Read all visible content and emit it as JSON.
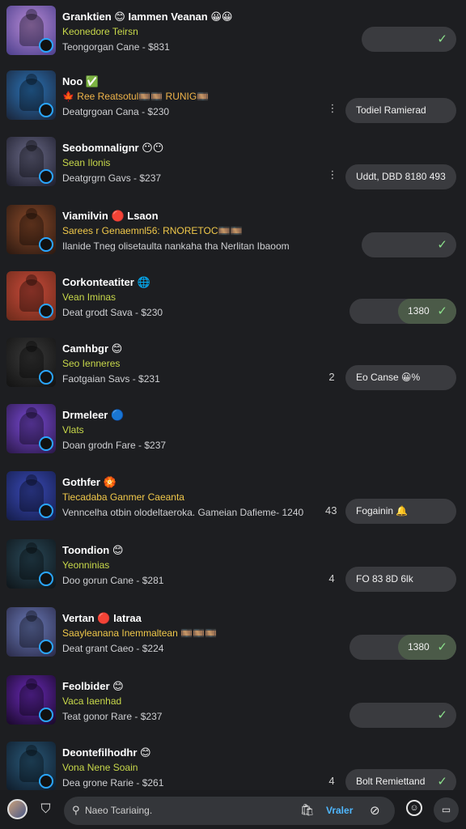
{
  "rows": [
    {
      "title": "Granktien 😊 Iammen Veanan 😀😀",
      "subtitle": "Keonedore Teirsn",
      "subtitle_color": "#c8d84a",
      "meta": "Teongorgan Cane - $831",
      "more": "",
      "pill_text": "",
      "pill_segment": "",
      "pill_check": "✓",
      "thumb_colors": [
        "#b98bd6",
        "#4b3f8c"
      ]
    },
    {
      "title": "Noo ✅",
      "subtitle": "🍁 Ree Reatsotul🎞️🎞️ RUNIG🎞️",
      "subtitle_color": "#f0b44a",
      "meta": "Deatgrgoan Cana - $230",
      "more": "⋮",
      "pill_text": "Todiel Ramierad",
      "pill_segment": "",
      "pill_check": "",
      "thumb_colors": [
        "#2b74b8",
        "#1a2438"
      ]
    },
    {
      "title": "Seobomnalignr 😶😶",
      "subtitle": "Sean Ilonis",
      "subtitle_color": "#c8d84a",
      "meta": "Deatgrgrn Gavs - $237",
      "more": "⋮",
      "pill_text": "Uddt, DBD 8180 493",
      "pill_segment": "",
      "pill_check": "",
      "thumb_colors": [
        "#6a6a88",
        "#1e1e2c"
      ]
    },
    {
      "title": "Viamilvin 🔴 Lsaon",
      "subtitle": "Sarees r Genaemnl56: RNORETOC🎞️🎞️",
      "subtitle_color": "#f0c84a",
      "meta": "Ilanide Tneg olisetaulta nankaha tha Nerlitan Ibaoom",
      "more": "",
      "pill_text": "",
      "pill_segment": "",
      "pill_check": "✓",
      "thumb_colors": [
        "#8a4a2a",
        "#2a1810"
      ]
    },
    {
      "title": "Corkonteatiter 🌐",
      "subtitle": "Vean Iminas",
      "subtitle_color": "#c8d84a",
      "meta": "Deat grodt Sava - $230",
      "more": "",
      "pill_text": "",
      "pill_segment": "1380",
      "pill_check": "✓",
      "thumb_colors": [
        "#c94a3a",
        "#6a2a1a"
      ]
    },
    {
      "title": "Camhbgr 😊",
      "subtitle": "Seo Ienneres",
      "subtitle_color": "#c8d84a",
      "meta": "Faotgaian Savs - $231",
      "more": "2",
      "pill_text": "Eo Canse 😀%",
      "pill_segment": "",
      "pill_check": "",
      "thumb_colors": [
        "#3a3a3a",
        "#121212"
      ]
    },
    {
      "title": "Drmeleer 🔵",
      "subtitle": "Vlats",
      "subtitle_color": "#c8d84a",
      "meta": "Doan grodn Fare - $237",
      "more": "",
      "pill_text": "",
      "pill_segment": "",
      "pill_check": "",
      "thumb_colors": [
        "#7a4ad6",
        "#2a1848"
      ]
    },
    {
      "title": "Gothfer 🏵️",
      "subtitle": "Tiecadaba Ganmer Caeanta",
      "subtitle_color": "#f0c84a",
      "meta": "Venncelha otbin olodeltaeroka. Gameian Dafieme- 1240",
      "more": "43",
      "pill_text": "Fogainin 🔔",
      "pill_segment": "",
      "pill_check": "",
      "thumb_colors": [
        "#3a4ab8",
        "#141c48"
      ]
    },
    {
      "title": "Toondion 😊",
      "subtitle": "Yeonninias",
      "subtitle_color": "#c8d84a",
      "meta": "Doo gorun Cane - $281",
      "more": "4",
      "pill_text": "FO 83 8D 6lk",
      "pill_segment": "",
      "pill_check": "",
      "thumb_colors": [
        "#2a4a5a",
        "#0e1418"
      ]
    },
    {
      "title": "Vertan 🔴 Iatraa",
      "subtitle": "Saayleanana Inemmaltean 🎞️🎞️🎞️",
      "subtitle_color": "#f0c84a",
      "meta": "Deat grant Caeo - $224",
      "more": "",
      "pill_text": "",
      "pill_segment": "1380",
      "pill_check": "✓",
      "thumb_colors": [
        "#6a7ab8",
        "#2a2a48"
      ]
    },
    {
      "title": "Feolbider 😊",
      "subtitle": "Vaca Iaenhad",
      "subtitle_color": "#c8d84a",
      "meta": "Teat gonor Rare - $237",
      "more": "",
      "pill_text": "",
      "pill_segment": "",
      "pill_check": "✓",
      "thumb_colors": [
        "#6a2ab8",
        "#180828"
      ]
    },
    {
      "title": "Deontefilhodhr 😊",
      "subtitle": "Vona Nene Soain",
      "subtitle_color": "#c8d84a",
      "meta": "Dea grone Rarie - $261",
      "more": "4",
      "pill_text": "Bolt Remiettand",
      "pill_segment": "",
      "pill_check": "✓",
      "thumb_colors": [
        "#2a5a7a",
        "#0e1a28"
      ]
    }
  ],
  "bottombar": {
    "search_placeholder": "Naeo Tcariaing.",
    "filter_label": "Vraler",
    "shield_icon": "shield-icon",
    "emoji_icon": "emoji-icon",
    "grid_icon": "grid-icon"
  }
}
